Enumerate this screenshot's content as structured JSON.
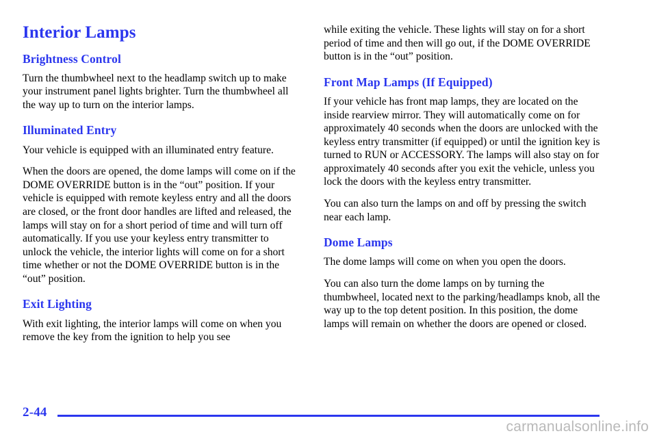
{
  "document": {
    "page_number": "2-44",
    "watermark": "carmanualsonline.info",
    "accent_color": "#2B36EE",
    "text_color": "#000000",
    "background_color": "#FFFFFF",
    "watermark_color": "#B9B9B9"
  },
  "left_column": {
    "section_title": "Interior Lamps",
    "blocks": {
      "brightness_heading": "Brightness Control",
      "brightness_p1": "Turn the thumbwheel next to the headlamp switch up to make your instrument panel lights brighter. Turn the thumbwheel all the way up to turn on the interior lamps.",
      "illuminated_heading": "Illuminated Entry",
      "illuminated_p1": "Your vehicle is equipped with an illuminated entry feature.",
      "illuminated_p2": "When the doors are opened, the dome lamps will come on if the DOME OVERRIDE button is in the “out” position. If your vehicle is equipped with remote keyless entry and all the doors are closed, or the front door handles are lifted and released, the lamps will stay on for a short period of time and will turn off automatically. If you use your keyless entry transmitter to unlock the vehicle, the interior lights will come on for a short time whether or not the DOME OVERRIDE button is in the “out” position.",
      "exit_heading": "Exit Lighting",
      "exit_p1": "With exit lighting, the interior lamps will come on when you remove the key from the ignition to help you see"
    }
  },
  "right_column": {
    "blocks": {
      "exit_continuation": "while exiting the vehicle. These lights will stay on for a short period of time and then will go out, if the DOME OVERRIDE button is in the “out” position.",
      "front_map_heading": "Front Map Lamps (If Equipped)",
      "front_map_p1": "If your vehicle has front map lamps, they are located on the inside rearview mirror. They will automatically come on for approximately 40 seconds when the doors are unlocked with the keyless entry transmitter (if equipped) or until the ignition key is turned to RUN or ACCESSORY. The lamps will also stay on for approximately 40 seconds after you exit the vehicle, unless you lock the doors with the keyless entry transmitter.",
      "front_map_p2": "You can also turn the lamps on and off by pressing the switch near each lamp.",
      "dome_heading": "Dome Lamps",
      "dome_p1": "The dome lamps will come on when you open the doors.",
      "dome_p2": "You can also turn the dome lamps on by turning the thumbwheel, located next to the parking/headlamps knob, all the way up to the top detent position. In this position, the dome lamps will remain on whether the doors are opened or closed."
    }
  }
}
